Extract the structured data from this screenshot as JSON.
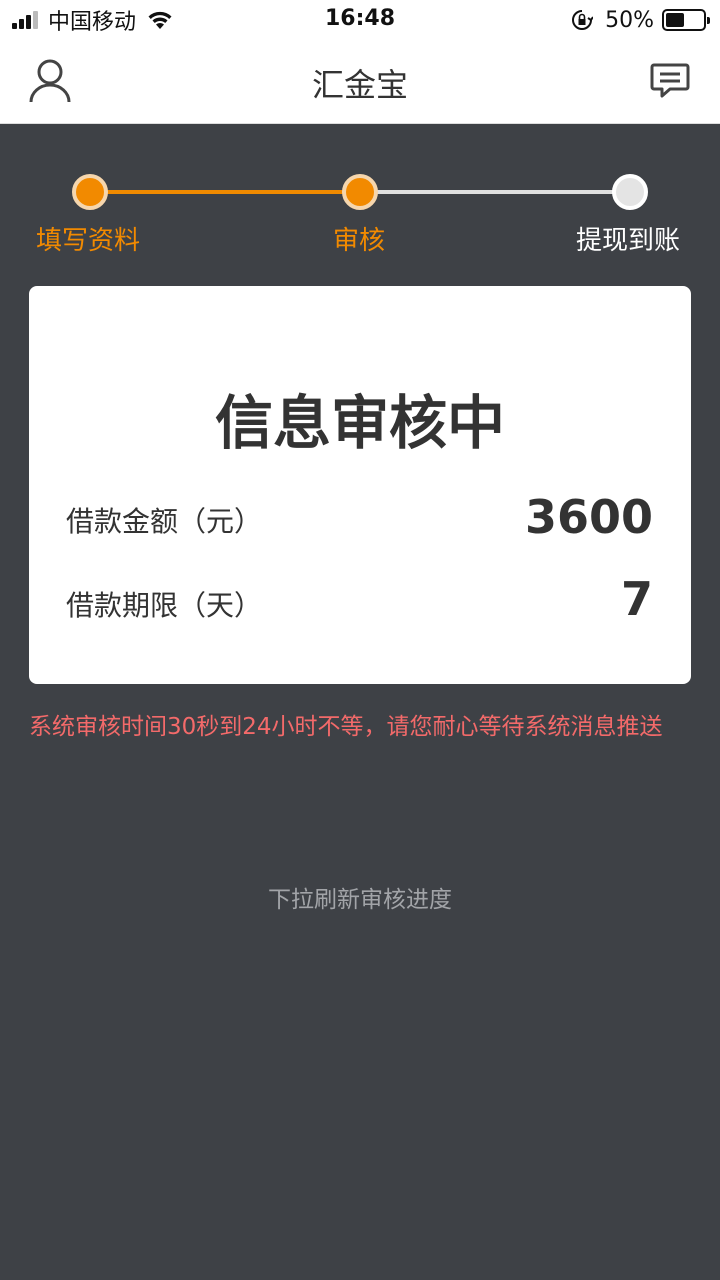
{
  "status_bar": {
    "carrier": "中国移动",
    "time": "16:48",
    "battery_percent_text": "50%",
    "battery_level": 0.5,
    "icons": [
      "signal-icon",
      "wifi-icon",
      "rotation-lock-icon",
      "battery-icon"
    ]
  },
  "nav": {
    "title": "汇金宝",
    "left_icon": "user-icon",
    "right_icon": "message-icon"
  },
  "steps": [
    {
      "label": "填写资料",
      "state": "done"
    },
    {
      "label": "审核",
      "state": "current"
    },
    {
      "label": "提现到账",
      "state": "pending"
    }
  ],
  "card": {
    "title": "信息审核中",
    "rows": [
      {
        "label": "借款金额（元）",
        "value": "3600"
      },
      {
        "label": "借款期限（天）",
        "value": "7"
      }
    ]
  },
  "notice": "系统审核时间30秒到24小时不等，请您耐心等待系统消息推送",
  "refresh_hint": "下拉刷新审核进度",
  "colors": {
    "accent": "#f28a00",
    "background": "#3e4146",
    "notice": "#f36a6a"
  }
}
